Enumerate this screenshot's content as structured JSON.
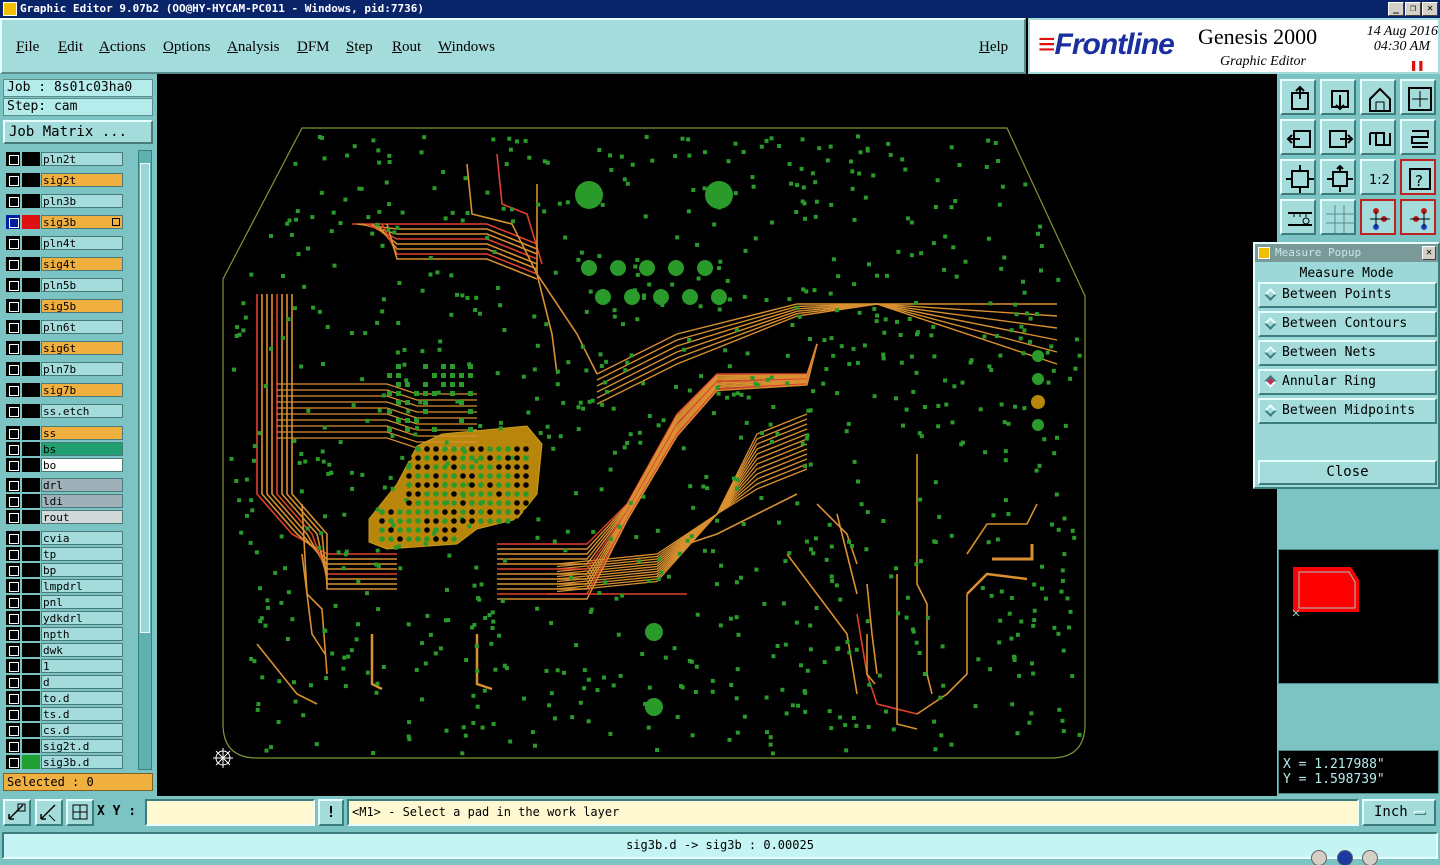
{
  "window": {
    "title": "Graphic Editor 9.07b2 (OO@HY-HYCAM-PC011 - Windows, pid:7736)"
  },
  "menu": [
    "File",
    "Edit",
    "Actions",
    "Options",
    "Analysis",
    "DFM",
    "Step",
    "Rout",
    "Windows"
  ],
  "help_label": "Help",
  "brand": {
    "logo": "Frontline",
    "product": "Genesis 2000",
    "subtitle": "Graphic Editor",
    "date": "14 Aug 2016",
    "time": "04:30 AM"
  },
  "job": {
    "job_line": "Job : 8s01c03ha0",
    "step_line": "Step: cam",
    "matrix_button": "Job Matrix ..."
  },
  "layers": [
    {
      "name": "pln2t",
      "color": "#a4dcdc"
    },
    {
      "name": "sig2t",
      "color": "#f0b040"
    },
    {
      "name": "pln3b",
      "color": "#a4dcdc"
    },
    {
      "name": "sig3b",
      "color": "#f0b040",
      "work": true
    },
    {
      "name": "pln4t",
      "color": "#a4dcdc"
    },
    {
      "name": "sig4t",
      "color": "#f0b040"
    },
    {
      "name": "pln5b",
      "color": "#a4dcdc"
    },
    {
      "name": "sig5b",
      "color": "#f0b040"
    },
    {
      "name": "pln6t",
      "color": "#a4dcdc"
    },
    {
      "name": "sig6t",
      "color": "#f0b040"
    },
    {
      "name": "pln7b",
      "color": "#a4dcdc"
    },
    {
      "name": "sig7b",
      "color": "#f0b040"
    },
    {
      "name": "ss.etch",
      "color": "#a4dcdc"
    },
    {
      "name": "ss",
      "color": "#f0b040"
    },
    {
      "name": "bs",
      "color": "#20a070"
    },
    {
      "name": "bo",
      "color": "#ffffff"
    },
    {
      "name": "drl",
      "color": "#a0b0b8"
    },
    {
      "name": "ldi",
      "color": "#a0b0b8"
    },
    {
      "name": "rout",
      "color": "#d0d8d8"
    },
    {
      "name": "cvia",
      "color": "#a4dcdc"
    },
    {
      "name": "tp",
      "color": "#a4dcdc"
    },
    {
      "name": "bp",
      "color": "#a4dcdc"
    },
    {
      "name": "lmpdrl",
      "color": "#a4dcdc"
    },
    {
      "name": "pnl",
      "color": "#a4dcdc"
    },
    {
      "name": "ydkdrl",
      "color": "#a4dcdc"
    },
    {
      "name": "npth",
      "color": "#a4dcdc"
    },
    {
      "name": "dwk",
      "color": "#a4dcdc"
    },
    {
      "name": "1",
      "color": "#a4dcdc"
    },
    {
      "name": "d",
      "color": "#a4dcdc"
    },
    {
      "name": "to.d",
      "color": "#a4dcdc"
    },
    {
      "name": "ts.d",
      "color": "#a4dcdc"
    },
    {
      "name": "cs.d",
      "color": "#a4dcdc"
    },
    {
      "name": "sig2t.d",
      "color": "#a4dcdc"
    },
    {
      "name": "sig3b.d",
      "color": "#a4dcdc"
    }
  ],
  "selected_text": "Selected : 0",
  "measure_popup": {
    "title": "Measure Popup",
    "heading": "Measure Mode",
    "options": [
      {
        "label": "Between Points",
        "selected": false
      },
      {
        "label": "Between Contours",
        "selected": false
      },
      {
        "label": "Between Nets",
        "selected": false
      },
      {
        "label": "Annular Ring",
        "selected": true
      },
      {
        "label": "Between Midpoints",
        "selected": false
      }
    ],
    "close_label": "Close"
  },
  "coords": {
    "x": "X = 1.217988\"",
    "y": "Y = 1.598739\""
  },
  "bottom": {
    "xy_label": "X Y :",
    "xy_value": "",
    "prompt": "<M1> - Select a pad in the work layer",
    "unit": "Inch",
    "status": "sig3b.d -> sig3b : 0.00025"
  },
  "toolbar_icons": [
    "zoom-in-icon",
    "zoom-out-icon",
    "home-icon",
    "fit-icon",
    "pan-left-icon",
    "pan-right-icon",
    "rotate-icon",
    "flip-icon",
    "zoom-fit-icon",
    "zoom-center-icon",
    "scale-1-2-icon",
    "help-icon",
    "ruler-icon",
    "grid-icon",
    "layer-a-icon",
    "layer-b-icon"
  ],
  "colors": {
    "panel": "#7cc4c4",
    "board_copper": "#b8860b",
    "trace": "#d89030",
    "pad": "#2a9a2a",
    "outline": "#7a9a3a",
    "red_trace": "#e04030"
  }
}
